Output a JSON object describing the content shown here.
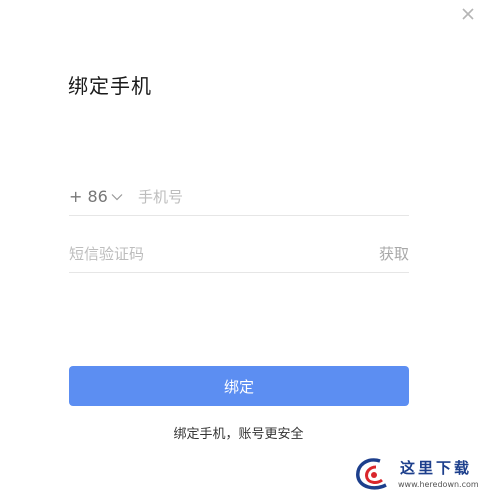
{
  "dialog": {
    "title": "绑定手机",
    "close_icon": "close-icon"
  },
  "phone": {
    "country_code": "+ 86",
    "country_chevron_icon": "chevron-down-icon",
    "placeholder": "手机号",
    "value": ""
  },
  "code": {
    "placeholder": "短信验证码",
    "value": "",
    "get_code_label": "获取"
  },
  "bind_button_label": "绑定",
  "hint": "绑定手机，账号更安全",
  "watermark": {
    "title": "这里下载",
    "url": "www.heredown.com"
  },
  "colors": {
    "primary": "#5c8ef2",
    "divider": "#e6e6e6",
    "placeholder": "#bdbdbd",
    "watermark_blue": "#1d3f8c",
    "watermark_red": "#d9262c"
  }
}
